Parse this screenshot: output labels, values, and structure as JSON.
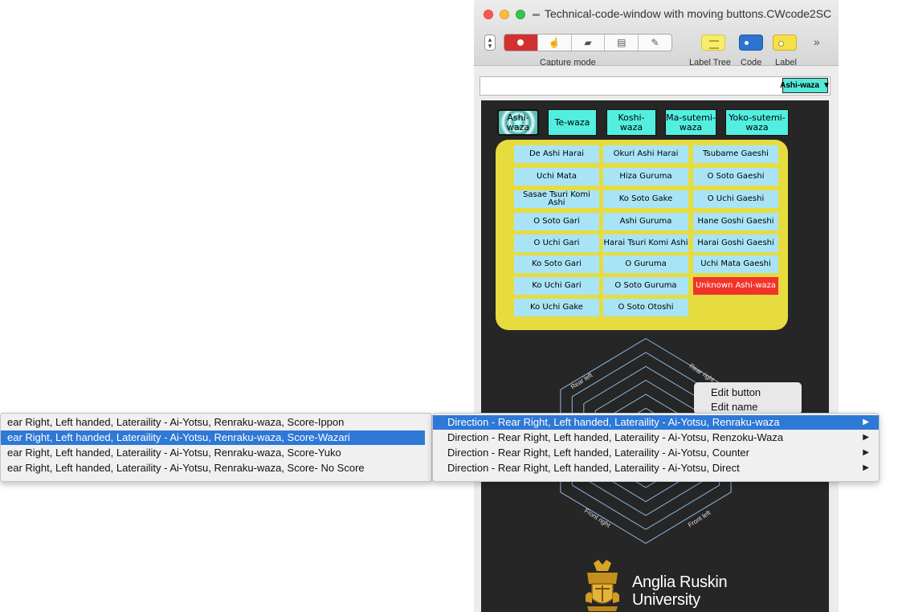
{
  "window": {
    "title": "Technical-code-window with moving buttons.CWcode2SC"
  },
  "toolbar": {
    "capture_mode_label": "Capture mode",
    "label_tree_label": "Label Tree",
    "code_label": "Code",
    "label_label": "Label",
    "overflow": "»"
  },
  "filter": {
    "selected": "Ashi-waza",
    "arrow": "▼"
  },
  "categories": [
    {
      "label": "Ashi-waza"
    },
    {
      "label": "Te-waza"
    },
    {
      "label": "Koshi-waza"
    },
    {
      "label": "Ma-sutemi-waza"
    },
    {
      "label": "Yoko-sutemi-waza"
    }
  ],
  "techniques": {
    "col1": [
      "De Ashi Harai",
      "Uchi Mata",
      "Sasae Tsuri Komi Ashi",
      "O Soto Gari",
      "O Uchi Gari",
      "Ko Soto Gari",
      "Ko Uchi Gari",
      "Ko Uchi Gake"
    ],
    "col2": [
      "Okuri Ashi Harai",
      "Hiza Guruma",
      "Ko Soto Gake",
      "Ashi Guruma",
      "Harai Tsuri Komi Ashi",
      "O Guruma",
      "O Soto Guruma",
      "O Soto Otoshi"
    ],
    "col3": [
      "Tsubame Gaeshi",
      "O Soto Gaeshi",
      "O Uchi Gaeshi",
      "Hane Goshi Gaeshi",
      "Harai Goshi Gaeshi",
      "Uchi Mata Gaeshi",
      "Unknown Ashi-waza"
    ]
  },
  "radar": {
    "labels": {
      "rear_left": "Rear left",
      "rear_right": "Rear right",
      "front_right": "Front right",
      "front_left": "Front left"
    }
  },
  "edit_popup": {
    "items": [
      "Edit button",
      "Edit name"
    ]
  },
  "menu_right": {
    "items": [
      "Direction - Rear Right, Left handed, Lateraility - Ai-Yotsu, Renraku-waza",
      "Direction - Rear Right, Left handed, Lateraility - Ai-Yotsu, Renzoku-Waza",
      "Direction - Rear Right, Left handed, Lateraility - Ai-Yotsu, Counter",
      "Direction - Rear Right, Left handed, Lateraility - Ai-Yotsu, Direct"
    ],
    "arrow": "▶"
  },
  "menu_left": {
    "items": [
      "ear Right, Left handed, Lateraility - Ai-Yotsu, Renraku-waza, Score-Ippon",
      "ear Right, Left handed, Lateraility - Ai-Yotsu, Renraku-waza, Score-Wazari",
      "ear Right, Left handed, Lateraility - Ai-Yotsu, Renraku-waza, Score-Yuko",
      "ear Right, Left handed, Lateraility - Ai-Yotsu, Renraku-waza, Score- No Score"
    ]
  },
  "logo": {
    "line1": "Anglia Ruskin",
    "line2": "University"
  },
  "colors": {
    "category_button": "#52efe0",
    "panel_yellow": "#e6dc3f",
    "technique_button": "#a9e4f6",
    "unknown_button": "#f2332a",
    "selection_blue": "#2e78d6",
    "canvas_dark": "#262626"
  }
}
